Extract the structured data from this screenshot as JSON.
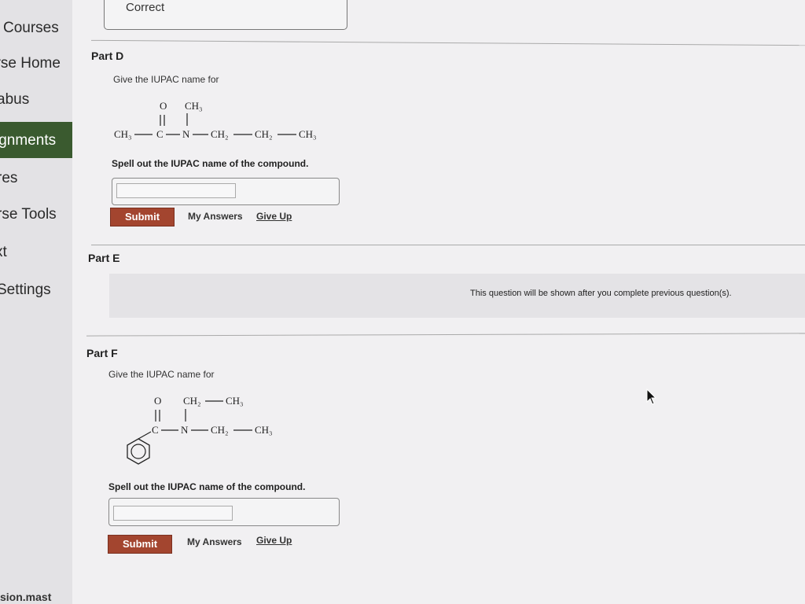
{
  "sidebar": {
    "items": [
      {
        "label": "Courses"
      },
      {
        "label": "urse Home"
      },
      {
        "label": "abus"
      },
      {
        "label": "ignments"
      },
      {
        "label": "res"
      },
      {
        "label": "rse Tools"
      },
      {
        "label": "xt"
      },
      {
        "label": "Settings"
      }
    ],
    "active_index": 3,
    "active_color": "#3a5a2f"
  },
  "feedback": {
    "text": "Correct"
  },
  "parts": {
    "d": {
      "label": "Part D",
      "prompt": "Give the IUPAC name for",
      "instruction": "Spell out the IUPAC name of the compound.",
      "input_value": "",
      "submit": "Submit",
      "my_answers": "My Answers",
      "give_up": "Give Up",
      "structure": {
        "O": "O",
        "CH3": "CH₃",
        "CH3_left": "CH₃",
        "C": "C",
        "N": "N",
        "CH2a": "CH₂",
        "CH2b": "CH₂",
        "CH3_right": "CH₃"
      }
    },
    "e": {
      "label": "Part E",
      "locked_message": "This question will be shown after you complete previous question(s)."
    },
    "f": {
      "label": "Part F",
      "prompt": "Give the IUPAC name for",
      "instruction": "Spell out the IUPAC name of the compound.",
      "input_value": "",
      "submit": "Submit",
      "my_answers": "My Answers",
      "give_up": "Give Up",
      "structure": {
        "O": "O",
        "CH2_top": "CH₂",
        "CH3_top": "CH₃",
        "C": "C",
        "N": "N",
        "CH2": "CH₂",
        "CH3": "CH₃"
      }
    }
  },
  "footer": {
    "url_fragment": "sion.mast"
  },
  "colors": {
    "submit": "#a3452f"
  }
}
